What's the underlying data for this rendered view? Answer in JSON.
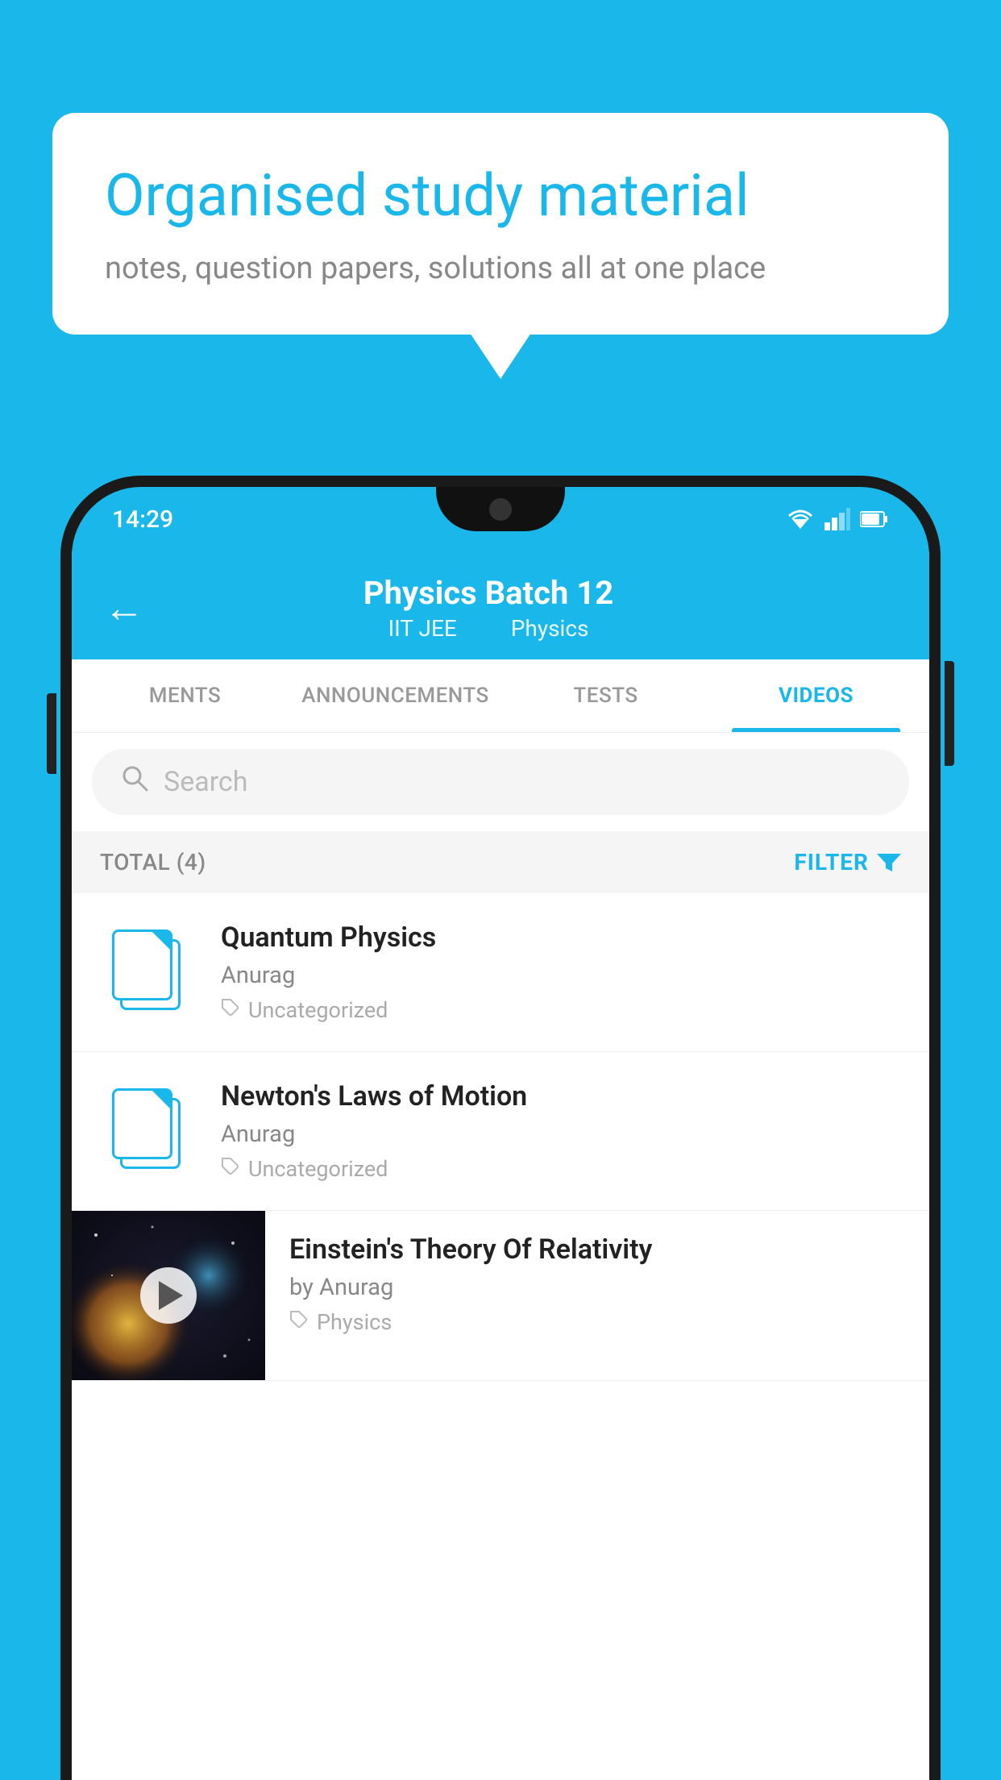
{
  "background_color": "#1ab7ea",
  "speech_bubble": {
    "heading": "Organised study material",
    "subtext": "notes, question papers, solutions all at one place"
  },
  "status_bar": {
    "time": "14:29"
  },
  "app_header": {
    "title": "Physics Batch 12",
    "subtitle_left": "IIT JEE",
    "subtitle_right": "Physics",
    "back_label": "←"
  },
  "tabs": [
    {
      "label": "MENTS",
      "active": false
    },
    {
      "label": "ANNOUNCEMENTS",
      "active": false
    },
    {
      "label": "TESTS",
      "active": false
    },
    {
      "label": "VIDEOS",
      "active": true
    }
  ],
  "search": {
    "placeholder": "Search"
  },
  "filter_bar": {
    "total_label": "TOTAL (4)",
    "filter_label": "FILTER"
  },
  "videos": [
    {
      "id": 1,
      "title": "Quantum Physics",
      "author": "Anurag",
      "tag": "Uncategorized",
      "has_thumbnail": false
    },
    {
      "id": 2,
      "title": "Newton's Laws of Motion",
      "author": "Anurag",
      "tag": "Uncategorized",
      "has_thumbnail": false
    },
    {
      "id": 3,
      "title": "Einstein's Theory Of Relativity",
      "author": "by Anurag",
      "tag": "Physics",
      "has_thumbnail": true
    }
  ]
}
